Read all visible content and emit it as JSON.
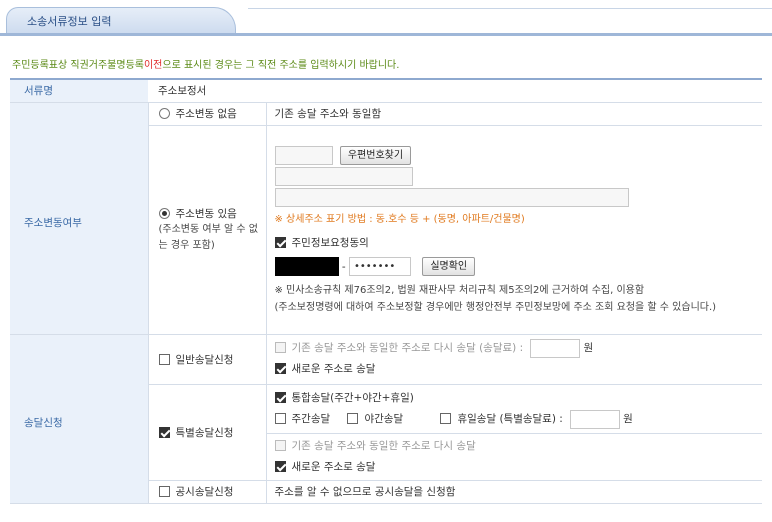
{
  "tab": {
    "title": "소송서류정보 입력"
  },
  "notice": {
    "prefix": "주민등록표상 직권거주불명등록",
    "red": "이전",
    "suffix": "으로 표시된 경우는 그 직전 주소를 입력하시기 바랍니다."
  },
  "doc": {
    "label": "서류명",
    "value": "주소보정서"
  },
  "address_change": {
    "label": "주소변동여부",
    "no_change": {
      "label": "주소변동 없음",
      "desc": "기존 송달 주소와 동일함",
      "selected": false
    },
    "changed": {
      "label": "주소변동 있음",
      "sub": "(주소변동 여부 알 수 없는 경우 포함)",
      "selected": true,
      "postcode_button": "우편번호찾기",
      "detail_hint": "※ 상세주소 표기 방법 : 동.호수 등 + (동명, 아파트/건물명)",
      "consent_label": "주민정보요청동의",
      "consent_checked": true,
      "id_sep": "-",
      "id_back": "•••••••",
      "verify_button": "실명확인",
      "law_note": "※ 민사소송규칙 제76조의2, 법원 재판사무 처리규칙 제5조의2에 근거하여 수집, 이용함",
      "law_note2": "(주소보정명령에 대하여 주소보정할 경우에만 행정안전부 주민정보망에 주소 조회 요청을 할 수 있습니다.)"
    }
  },
  "delivery": {
    "label": "송달신청",
    "general": {
      "label": "일반송달신청",
      "checked": false,
      "opt_same": "기존 송달 주소와 동일한 주소로 다시 송달  (송달료) :",
      "opt_same_unit": "원",
      "opt_new": "새로운 주소로 송달",
      "opt_new_checked": true
    },
    "special": {
      "label": "특별송달신청",
      "checked": true,
      "integrated": "통합송달(주간+야간+휴일)",
      "integrated_checked": true,
      "day": "주간송달",
      "night": "야간송달",
      "holiday": "휴일송달  (특별송달료) :",
      "holiday_unit": "원",
      "opt_same": "기존 송달 주소와 동일한 주소로 다시 송달",
      "opt_new": "새로운 주소로 송달",
      "opt_new_checked": true
    },
    "public": {
      "label": "공시송달신청",
      "checked": false,
      "desc": "주소를 알 수 없으므로 공시송달을 신청함"
    }
  }
}
